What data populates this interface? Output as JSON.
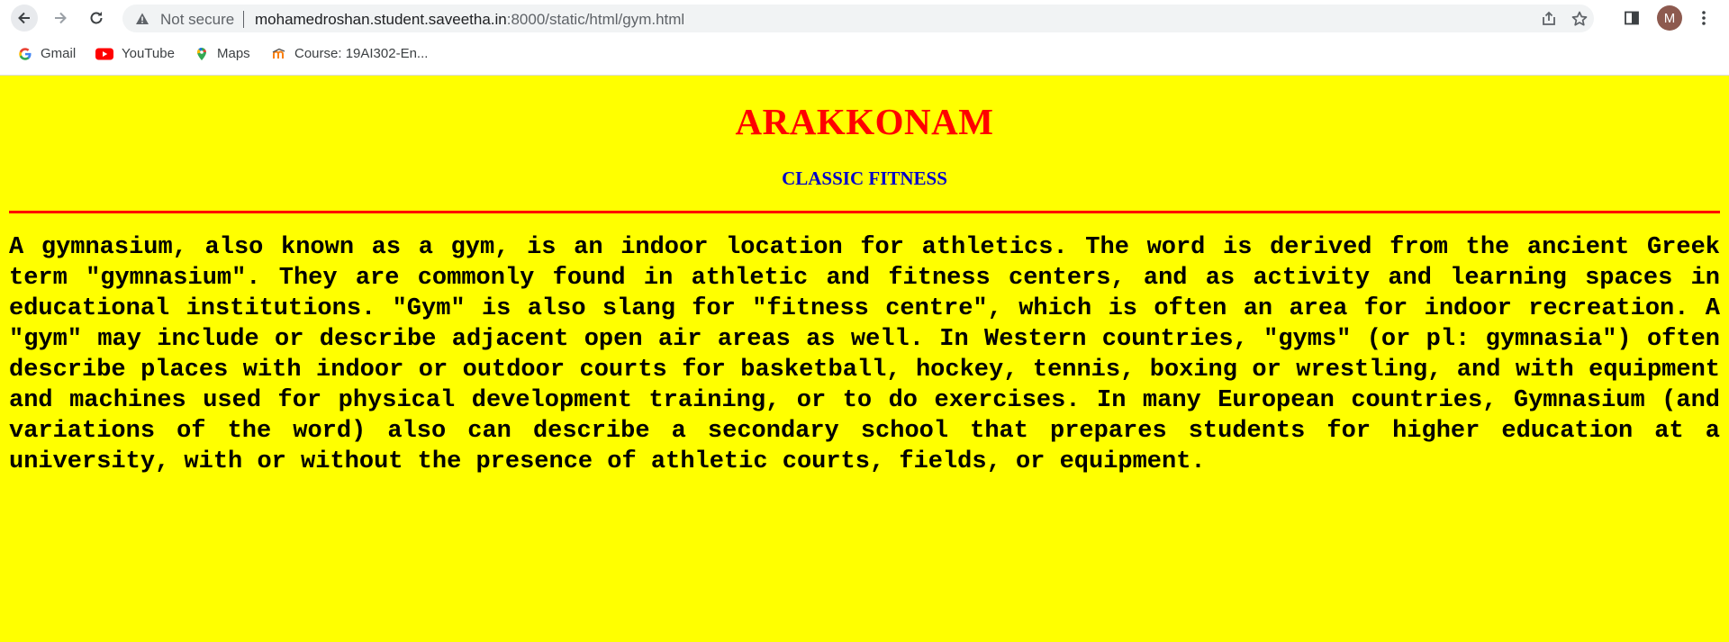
{
  "browser": {
    "security_label": "Not secure",
    "url_host": "mohamedroshan.student.saveetha.in",
    "url_rest": ":8000/static/html/gym.html",
    "profile_initial": "M",
    "bookmarks": [
      {
        "label": "Gmail",
        "icon": "google-icon"
      },
      {
        "label": "YouTube",
        "icon": "youtube-icon"
      },
      {
        "label": "Maps",
        "icon": "maps-pin-icon"
      },
      {
        "label": "Course: 19AI302-En...",
        "icon": "moodle-icon"
      }
    ]
  },
  "page": {
    "title": "ARAKKONAM",
    "subtitle": "CLASSIC FITNESS",
    "paragraph": "A gymnasium, also known as a gym, is an indoor location for athletics. The word is derived from the ancient Greek term \"gymnasium\". They are commonly found in athletic and fitness centers, and as activity and learning spaces in educational institutions. \"Gym\" is also slang for \"fitness centre\", which is often an area for indoor recreation. A \"gym\" may include or describe adjacent open air areas as well. In Western countries, \"gyms\" (or pl: gymnasia\") often describe places with indoor or outdoor courts for basketball, hockey, tennis, boxing or wrestling, and with equipment and machines used for physical development training, or to do exercises. In many European countries, Gymnasium (and variations of the word) also can describe a secondary school that prepares students for higher education at a university, with or without the presence of athletic courts, fields, or equipment.",
    "colors": {
      "background": "#ffff00",
      "title": "#ff0000",
      "subtitle": "#0000cc",
      "rule": "#ff0000",
      "text": "#000000"
    }
  }
}
